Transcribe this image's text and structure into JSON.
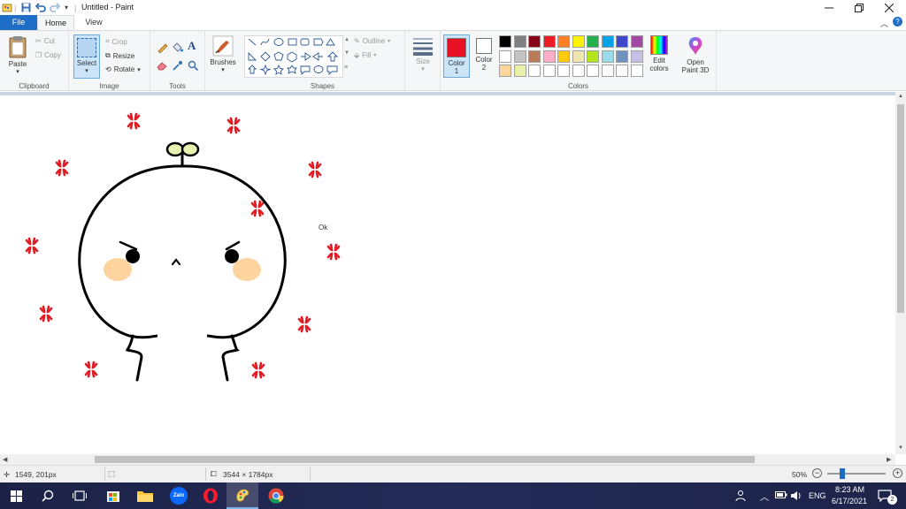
{
  "window": {
    "title": "Untitled - Paint",
    "controls": [
      "minimize",
      "restore",
      "close"
    ]
  },
  "ribbon_tabs": {
    "file": "File",
    "home": "Home",
    "view": "View"
  },
  "clipboard": {
    "paste": "Paste",
    "cut": "Cut",
    "copy": "Copy",
    "label": "Clipboard"
  },
  "image": {
    "select": "Select",
    "crop": "Crop",
    "resize": "Resize",
    "rotate": "Rotate",
    "label": "Image"
  },
  "tools": {
    "label": "Tools"
  },
  "brushes": {
    "label": "Brushes"
  },
  "shapes": {
    "outline": "Outline",
    "fill": "Fill",
    "label": "Shapes"
  },
  "size": {
    "label": "Size"
  },
  "colors": {
    "color1_line1": "Color",
    "color1_line2": "1",
    "color2_line1": "Color",
    "color2_line2": "2",
    "edit_line1": "Edit",
    "edit_line2": "colors",
    "paint3d_line1": "Open",
    "paint3d_line2": "Paint 3D",
    "label": "Colors",
    "color1": "#e81123",
    "color2": "#ffffff",
    "palette_row1": [
      "#000000",
      "#7f7f7f",
      "#880015",
      "#ed1c24",
      "#ff7f27",
      "#fff200",
      "#22b14c",
      "#00a2e8",
      "#3f48cc",
      "#a349a4"
    ],
    "palette_row2": [
      "#ffffff",
      "#c3c3c3",
      "#b97a57",
      "#ffaec9",
      "#ffc90e",
      "#efe4b0",
      "#b5e61d",
      "#99d9ea",
      "#7092be",
      "#c8bfe7"
    ],
    "palette_row3": [
      "#fbd59a",
      "#e9f0a8",
      "#ffffff",
      "#ffffff",
      "#ffffff",
      "#ffffff",
      "#ffffff",
      "#ffffff",
      "#ffffff",
      "#ffffff"
    ]
  },
  "status": {
    "cursor_pos": "1549, 201px",
    "canvas_size": "3544 × 1784px",
    "zoom": "50%"
  },
  "taskbar": {
    "lang": "ENG",
    "time": "8:23 AM",
    "date": "6/17/2021",
    "notifications": "2",
    "zalo": "Zalo"
  },
  "drawing": {
    "signature": "Ok",
    "accent_red": "#e01b24",
    "blush": "#fdd49e",
    "sprout": "#e7f2b0"
  }
}
